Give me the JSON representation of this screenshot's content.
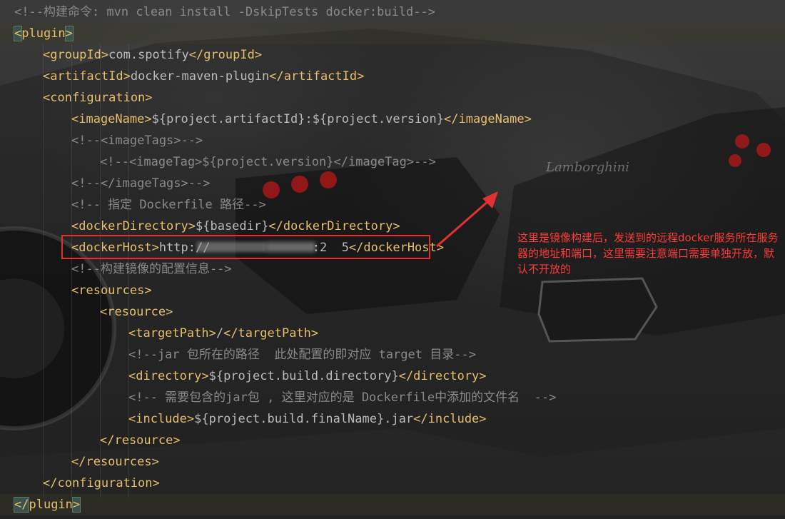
{
  "editor": {
    "lines": [
      {
        "indent": 0,
        "parts": [
          {
            "c": "comment",
            "t": "<!--构建命令: mvn clean install -DskipTests docker:build-->"
          }
        ]
      },
      {
        "indent": 0,
        "current": true,
        "parts": [
          {
            "c": "bracket-hl",
            "t": "<"
          },
          {
            "c": "tag",
            "t": "plugin"
          },
          {
            "c": "bracket-hl",
            "t": ">"
          }
        ]
      },
      {
        "indent": 1,
        "parts": [
          {
            "c": "tag",
            "t": "<groupId>"
          },
          {
            "c": "txt",
            "t": "com.spotify"
          },
          {
            "c": "tag",
            "t": "</groupId>"
          }
        ]
      },
      {
        "indent": 1,
        "parts": [
          {
            "c": "tag",
            "t": "<artifactId>"
          },
          {
            "c": "txt",
            "t": "docker-maven-plugin"
          },
          {
            "c": "tag",
            "t": "</artifactId>"
          }
        ]
      },
      {
        "indent": 1,
        "parts": [
          {
            "c": "tag",
            "t": "<configuration>"
          }
        ]
      },
      {
        "indent": 2,
        "parts": [
          {
            "c": "tag",
            "t": "<imageName>"
          },
          {
            "c": "txt",
            "t": "${project.artifactId}:${project.version}"
          },
          {
            "c": "tag",
            "t": "</imageName>"
          }
        ]
      },
      {
        "indent": 2,
        "parts": [
          {
            "c": "comment",
            "t": "<!--<imageTags>-->"
          }
        ]
      },
      {
        "indent": 3,
        "parts": [
          {
            "c": "comment",
            "t": "<!--<imageTag>${project.version}</imageTag>-->"
          }
        ]
      },
      {
        "indent": 2,
        "parts": [
          {
            "c": "comment",
            "t": "<!--</imageTags>-->"
          }
        ]
      },
      {
        "indent": 2,
        "parts": [
          {
            "c": "comment",
            "t": "<!-- 指定 Dockerfile 路径-->"
          }
        ]
      },
      {
        "indent": 2,
        "parts": [
          {
            "c": "tag",
            "t": "<dockerDirectory>"
          },
          {
            "c": "txt",
            "t": "${basedir}"
          },
          {
            "c": "tag",
            "t": "</dockerDirectory>"
          }
        ]
      },
      {
        "indent": 2,
        "parts": [
          {
            "c": "tag",
            "t": "<dockerHost>"
          },
          {
            "c": "txt",
            "t": "http://              :2  5"
          },
          {
            "c": "tag",
            "t": "</dockerHost>"
          }
        ]
      },
      {
        "indent": 2,
        "parts": [
          {
            "c": "comment",
            "t": "<!--构建镜像的配置信息-->"
          }
        ]
      },
      {
        "indent": 2,
        "parts": [
          {
            "c": "tag",
            "t": "<resources>"
          }
        ]
      },
      {
        "indent": 3,
        "parts": [
          {
            "c": "tag",
            "t": "<resource>"
          }
        ]
      },
      {
        "indent": 4,
        "parts": [
          {
            "c": "tag",
            "t": "<targetPath>"
          },
          {
            "c": "txt",
            "t": "/"
          },
          {
            "c": "tag",
            "t": "</targetPath>"
          }
        ]
      },
      {
        "indent": 4,
        "parts": [
          {
            "c": "comment",
            "t": "<!--jar 包所在的路径  此处配置的即对应 target 目录-->"
          }
        ]
      },
      {
        "indent": 4,
        "parts": [
          {
            "c": "tag",
            "t": "<directory>"
          },
          {
            "c": "txt",
            "t": "${project.build.directory}"
          },
          {
            "c": "tag",
            "t": "</directory>"
          }
        ]
      },
      {
        "indent": 4,
        "parts": [
          {
            "c": "comment",
            "t": "<!-- 需要包含的jar包 , 这里对应的是 Dockerfile中添加的文件名  -->"
          }
        ]
      },
      {
        "indent": 4,
        "parts": [
          {
            "c": "tag",
            "t": "<include>"
          },
          {
            "c": "txt",
            "t": "${project.build.finalName}.jar"
          },
          {
            "c": "tag",
            "t": "</include>"
          }
        ]
      },
      {
        "indent": 3,
        "parts": [
          {
            "c": "tag",
            "t": "</resource>"
          }
        ]
      },
      {
        "indent": 2,
        "parts": [
          {
            "c": "tag",
            "t": "</resources>"
          }
        ]
      },
      {
        "indent": 1,
        "parts": [
          {
            "c": "tag",
            "t": "</configuration>"
          }
        ]
      },
      {
        "indent": 0,
        "current": true,
        "parts": [
          {
            "c": "bracket-hl",
            "t": "</"
          },
          {
            "c": "tag",
            "t": "plugin"
          },
          {
            "c": "bracket-hl",
            "t": ">"
          }
        ]
      }
    ]
  },
  "annotation": {
    "text": "这里是镜像构建后，发送到的远程docker服务所在服务器的地址和端口，这里需要注意端口需要单独开放，默认不开放的"
  },
  "background": {
    "brand_text": "Lamborghini"
  },
  "colors": {
    "highlight_box": "#e53030",
    "annotation": "#ff3b3b",
    "tag": "#e8bf6a",
    "comment": "#8a8a8a"
  }
}
